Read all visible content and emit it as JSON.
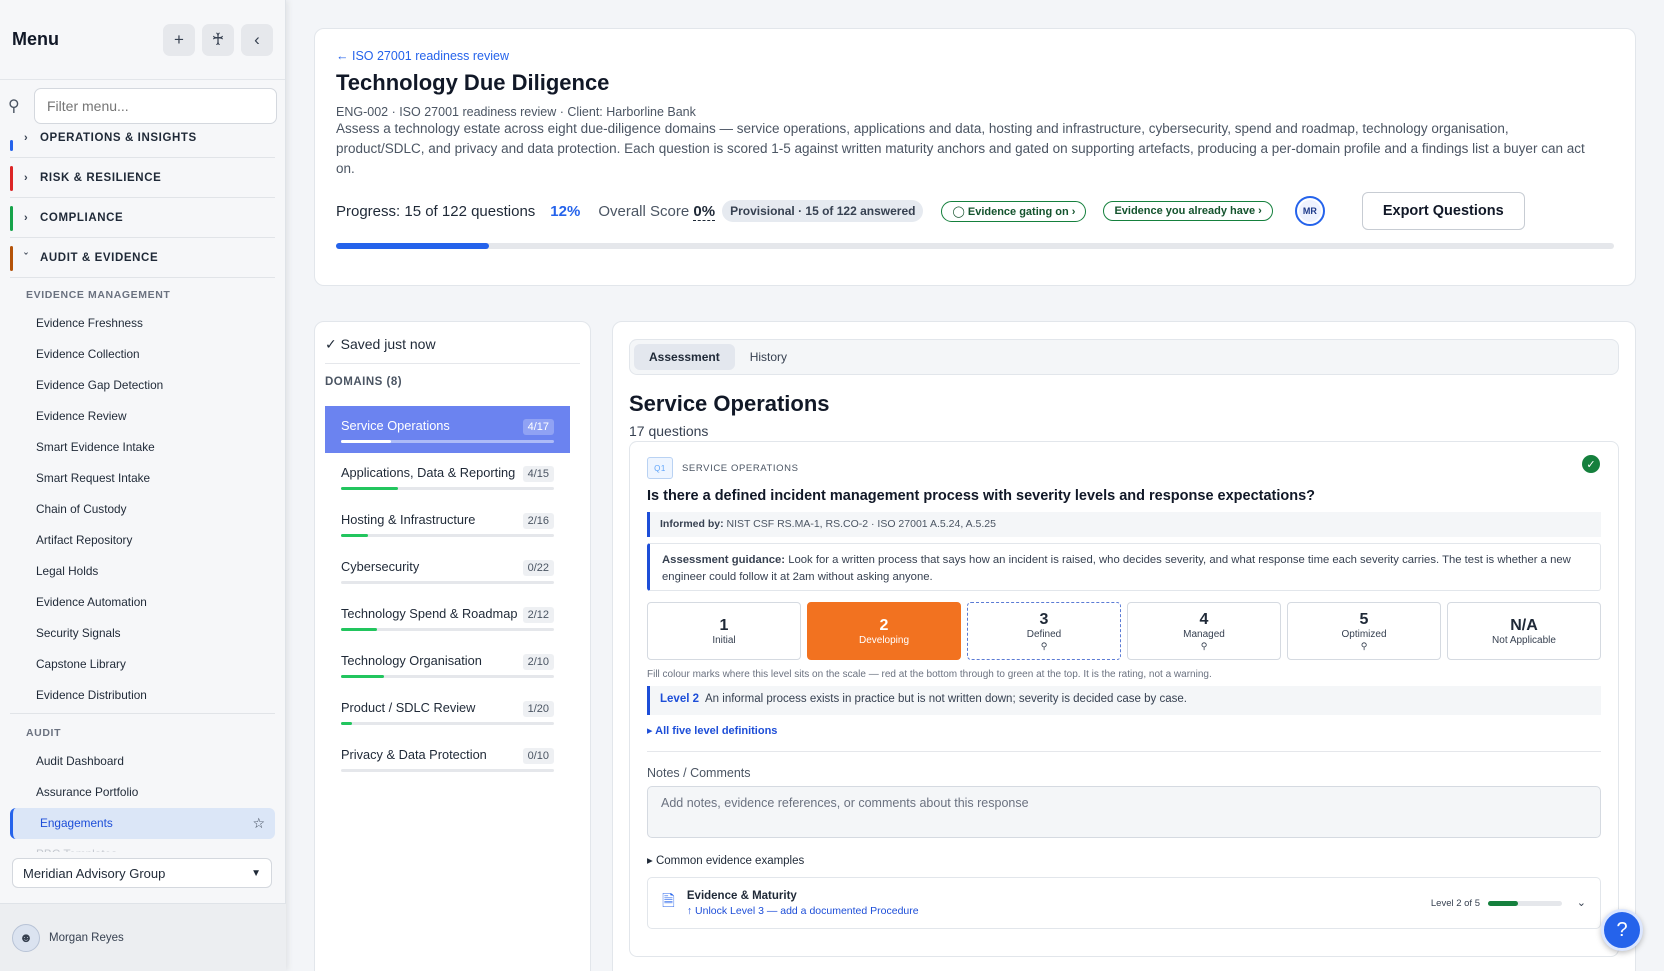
{
  "sidebar": {
    "title": "Menu",
    "filter_placeholder": "Filter menu...",
    "sections": [
      {
        "label": "OPERATIONS & INSIGHTS",
        "color": "#2563eb"
      },
      {
        "label": "RISK & RESILIENCE",
        "color": "#dc2626"
      },
      {
        "label": "COMPLIANCE",
        "color": "#16a34a"
      },
      {
        "label": "AUDIT & EVIDENCE",
        "color": "#b45309"
      }
    ],
    "groups": {
      "evidence_management": "EVIDENCE MANAGEMENT",
      "audit": "AUDIT"
    },
    "evidence_items": [
      "Evidence Freshness",
      "Evidence Collection",
      "Evidence Gap Detection",
      "Evidence Review",
      "Smart Evidence Intake",
      "Smart Request Intake",
      "Chain of Custody",
      "Artifact Repository",
      "Legal Holds",
      "Evidence Automation",
      "Security Signals",
      "Capstone Library",
      "Evidence Distribution"
    ],
    "audit_items": [
      "Audit Dashboard",
      "Assurance Portfolio",
      "Engagements",
      "PBC Templates"
    ],
    "org": "Meridian Advisory Group",
    "user": "Morgan Reyes"
  },
  "header": {
    "back_link": "← ISO 27001 readiness review",
    "title": "Technology Due Diligence",
    "meta": "ENG-002 · ISO 27001 readiness review · Client: Harborline Bank",
    "description": "Assess a technology estate across eight due-diligence domains — service operations, applications and data, hosting and infrastructure, cybersecurity, spend and roadmap, technology organisation, product/SDLC, and privacy and data protection. Each question is scored 1-5 against written maturity anchors and gated on supporting artefacts, producing a per-domain profile and a findings list a buyer can act on.",
    "progress_label": "Progress: 15 of 122 questions",
    "progress_pct": "12%",
    "progress_value": 0.12,
    "overall_label": "Overall Score",
    "overall_value": "0%",
    "provisional": "Provisional · 15 of 122 answered",
    "gating_pill": "Evidence gating on",
    "have_pill": "Evidence you already have",
    "avatar_initials": "MR",
    "export_label": "Export Questions"
  },
  "domains": {
    "saved": "✓ Saved just now",
    "heading": "DOMAINS (8)",
    "list": [
      {
        "name": "Service Operations",
        "count": "4/17",
        "progress": 0.235
      },
      {
        "name": "Applications, Data & Reporting",
        "count": "4/15",
        "progress": 0.267
      },
      {
        "name": "Hosting & Infrastructure",
        "count": "2/16",
        "progress": 0.125
      },
      {
        "name": "Cybersecurity",
        "count": "0/22",
        "progress": 0
      },
      {
        "name": "Technology Spend & Roadmap",
        "count": "2/12",
        "progress": 0.167
      },
      {
        "name": "Technology Organisation",
        "count": "2/10",
        "progress": 0.2
      },
      {
        "name": "Product / SDLC Review",
        "count": "1/20",
        "progress": 0.05
      },
      {
        "name": "Privacy & Data Protection",
        "count": "0/10",
        "progress": 0
      }
    ]
  },
  "main": {
    "tabs": [
      "Assessment",
      "History"
    ],
    "domain_title": "Service Operations",
    "question_count": "17 questions",
    "question": {
      "badge": "Q1",
      "tag": "SERVICE OPERATIONS",
      "title": "Is there a defined incident management process with severity levels and response expectations?",
      "informed_label": "Informed by:",
      "informed_text": "NIST CSF RS.MA-1, RS.CO-2 · ISO 27001 A.5.24, A.5.25",
      "guidance_label": "Assessment guidance:",
      "guidance_text": "Look for a written process that says how an incident is raised, who decides severity, and what response time each severity carries. The test is whether a new engineer could follow it at 2am without asking anyone.",
      "levels": [
        {
          "n": "1",
          "label": "Initial"
        },
        {
          "n": "2",
          "label": "Developing"
        },
        {
          "n": "3",
          "label": "Defined"
        },
        {
          "n": "4",
          "label": "Managed"
        },
        {
          "n": "5",
          "label": "Optimized"
        },
        {
          "n": "N/A",
          "label": "Not Applicable"
        }
      ],
      "fill_note": "Fill colour marks where this level sits on the scale — red at the bottom through to green at the top. It is the rating, not a warning.",
      "level_label": "Level 2",
      "level_text": "An informal process exists in practice but is not written down; severity is decided case by case.",
      "all_defs": "▸ All five level definitions",
      "notes_label": "Notes / Comments",
      "notes_placeholder": "Add notes, evidence references, or comments about this response",
      "common_evidence": "▸ Common evidence examples",
      "evidence_title": "Evidence & Maturity",
      "evidence_unlock": "↑ Unlock Level 3 — add a documented Procedure",
      "evidence_level": "Level 2 of 5",
      "evidence_progress": 0.4
    }
  }
}
